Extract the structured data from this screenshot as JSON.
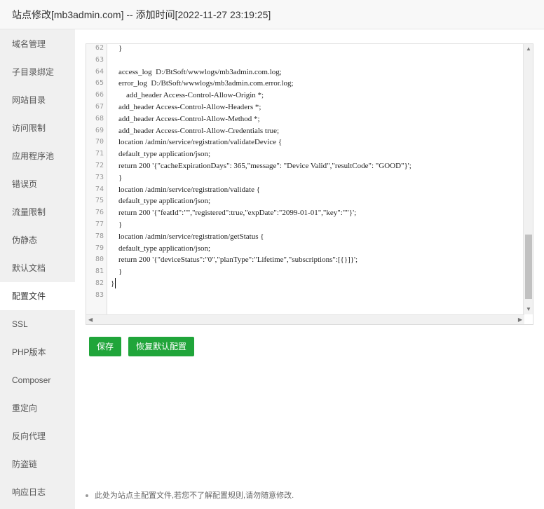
{
  "title": "站点修改[mb3admin.com] -- 添加时间[2022-11-27 23:19:25]",
  "sidebar": {
    "items": [
      {
        "label": "域名管理"
      },
      {
        "label": "子目录绑定"
      },
      {
        "label": "网站目录"
      },
      {
        "label": "访问限制"
      },
      {
        "label": "应用程序池"
      },
      {
        "label": "错误页"
      },
      {
        "label": "流量限制"
      },
      {
        "label": "伪静态"
      },
      {
        "label": "默认文档"
      },
      {
        "label": "配置文件",
        "active": true
      },
      {
        "label": "SSL"
      },
      {
        "label": "PHP版本"
      },
      {
        "label": "Composer"
      },
      {
        "label": "重定向"
      },
      {
        "label": "反向代理"
      },
      {
        "label": "防盗链"
      },
      {
        "label": "响应日志"
      }
    ]
  },
  "editor": {
    "lines": [
      {
        "num": "62",
        "text": "    }"
      },
      {
        "num": "63",
        "text": ""
      },
      {
        "num": "64",
        "text": "    access_log  D:/BtSoft/wwwlogs/mb3admin.com.log;"
      },
      {
        "num": "65",
        "text": "    error_log  D:/BtSoft/wwwlogs/mb3admin.com.error.log;"
      },
      {
        "num": "66",
        "text": "        add_header Access-Control-Allow-Origin *;"
      },
      {
        "num": "67",
        "text": "    add_header Access-Control-Allow-Headers *;"
      },
      {
        "num": "68",
        "text": "    add_header Access-Control-Allow-Method *;"
      },
      {
        "num": "69",
        "text": "    add_header Access-Control-Allow-Credentials true;"
      },
      {
        "num": "70",
        "text": "    location /admin/service/registration/validateDevice {"
      },
      {
        "num": "71",
        "text": "    default_type application/json;"
      },
      {
        "num": "72",
        "text": "    return 200 '{\"cacheExpirationDays\": 365,\"message\": \"Device Valid\",\"resultCode\": \"GOOD\"}';"
      },
      {
        "num": "73",
        "text": "    }"
      },
      {
        "num": "74",
        "text": "    location /admin/service/registration/validate {"
      },
      {
        "num": "75",
        "text": "    default_type application/json;"
      },
      {
        "num": "76",
        "text": "    return 200 '{\"featId\":\"\",\"registered\":true,\"expDate\":\"2099-01-01\",\"key\":\"\"}';"
      },
      {
        "num": "77",
        "text": "    }"
      },
      {
        "num": "78",
        "text": "    location /admin/service/registration/getStatus {"
      },
      {
        "num": "79",
        "text": "    default_type application/json;"
      },
      {
        "num": "80",
        "text": "    return 200 '{\"deviceStatus\":\"0\",\"planType\":\"Lifetime\",\"subscriptions\":[{}]}';"
      },
      {
        "num": "81",
        "text": "    }"
      },
      {
        "num": "82",
        "text": "}"
      },
      {
        "num": "83",
        "text": ""
      }
    ]
  },
  "buttons": {
    "save": "保存",
    "restore": "恢复默认配置"
  },
  "note": "此处为站点主配置文件,若您不了解配置规则,请勿随意修改."
}
